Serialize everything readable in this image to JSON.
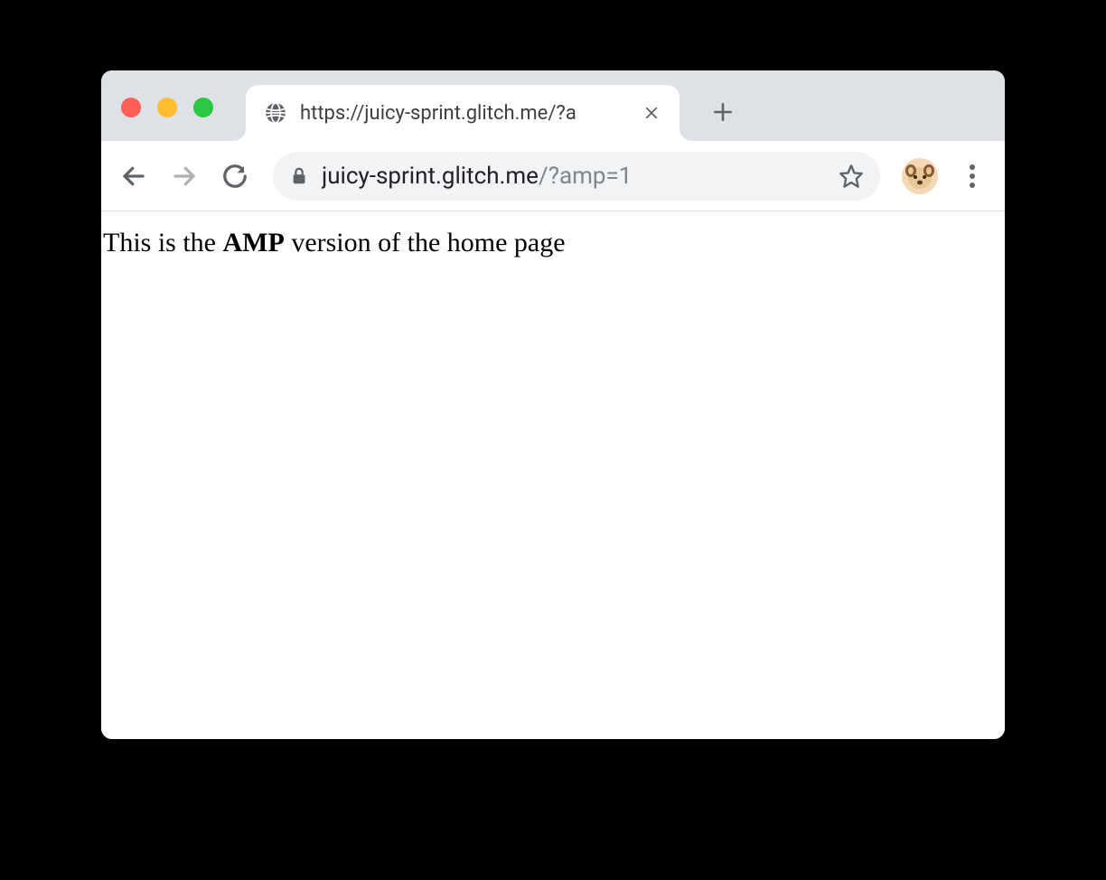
{
  "window": {
    "traffic_lights": [
      "close",
      "minimize",
      "maximize"
    ]
  },
  "tab": {
    "title": "https://juicy-sprint.glitch.me/?a",
    "favicon": "globe-icon"
  },
  "toolbar": {
    "back_enabled": true,
    "forward_enabled": false,
    "url_host": "juicy-sprint.glitch.me",
    "url_path": "/?amp=1"
  },
  "page": {
    "text_before": "This is the ",
    "text_bold": "AMP",
    "text_after": " version of the home page"
  }
}
